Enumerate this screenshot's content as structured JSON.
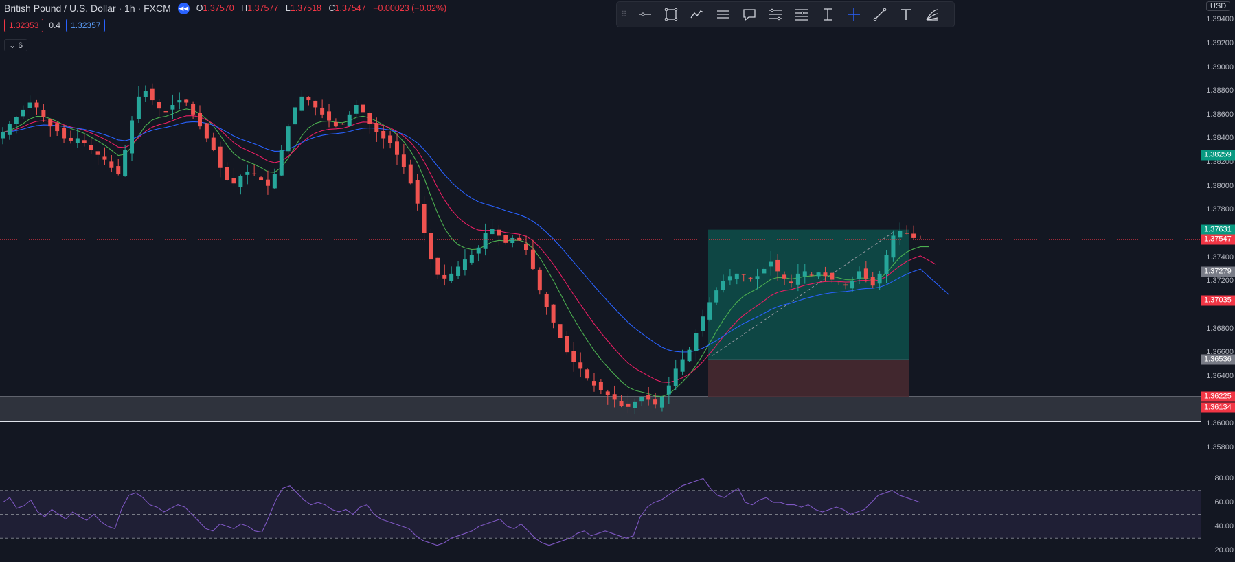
{
  "header": {
    "symbol_title": "British Pound / U.S. Dollar · 1h · FXCM",
    "replay_icon": "replay-icon",
    "ohlc": [
      {
        "label": "O",
        "value": "1.37570"
      },
      {
        "label": "H",
        "value": "1.37577"
      },
      {
        "label": "L",
        "value": "1.37518"
      },
      {
        "label": "C",
        "value": "1.37547"
      },
      {
        "label": "",
        "value": "−0.00023 (−0.02%)"
      }
    ]
  },
  "indicator": {
    "value_left": "1.32353",
    "param": "0.4",
    "value_right": "1.32357"
  },
  "collapse_label": "6",
  "currency_button": "USD",
  "toolbar": {
    "tools": [
      "horizontal-ray-icon",
      "rectangle-icon",
      "path-icon",
      "parallel-lines-icon",
      "callout-icon",
      "position-icon",
      "fib-icon",
      "price-range-icon",
      "crosshair-icon",
      "trend-line-icon",
      "text-icon",
      "fib-fan-icon"
    ]
  },
  "colors": {
    "background": "#131722",
    "bull": "#26a69a",
    "bear": "#ef5350",
    "ma_fast": "#4caf50",
    "ma_mid": "#e91e63",
    "ma_slow": "#2962ff",
    "rsi": "#7e57c2",
    "target_zone": "#0e4f4a",
    "stop_zone": "#4a2a30"
  },
  "chart_data": {
    "type": "candlestick",
    "timeframe": "1h",
    "ylim": [
      1.357,
      1.395
    ],
    "y_ticks": [
      "1.39400",
      "1.39200",
      "1.39000",
      "1.38800",
      "1.38600",
      "1.38400",
      "1.38200",
      "1.38000",
      "1.37800",
      "1.37400",
      "1.37200",
      "1.36800",
      "1.36600",
      "1.36400",
      "1.36000",
      "1.35800"
    ],
    "price_labels": [
      {
        "value": "1.38259",
        "price": 1.38259,
        "color": "#089981"
      },
      {
        "value": "1.37631",
        "price": 1.37631,
        "color": "#089981"
      },
      {
        "value": "1.37547",
        "price": 1.37547,
        "color": "#f23645"
      },
      {
        "value": "1.37279",
        "price": 1.37279,
        "color": "#787b86"
      },
      {
        "value": "1.37035",
        "price": 1.37035,
        "color": "#f23645"
      },
      {
        "value": "1.36536",
        "price": 1.36536,
        "color": "#787b86"
      },
      {
        "value": "1.36225",
        "price": 1.36225,
        "color": "#f23645"
      },
      {
        "value": "1.36134",
        "price": 1.36134,
        "color": "#f23645"
      }
    ],
    "close_series": [
      1.3845,
      1.3852,
      1.3858,
      1.3864,
      1.387,
      1.3866,
      1.3858,
      1.385,
      1.3846,
      1.384,
      1.3838,
      1.384,
      1.3836,
      1.383,
      1.3826,
      1.3822,
      1.3815,
      1.381,
      1.383,
      1.3855,
      1.3875,
      1.388,
      1.3872,
      1.3865,
      1.3862,
      1.3868,
      1.3872,
      1.387,
      1.386,
      1.385,
      1.384,
      1.383,
      1.3815,
      1.3805,
      1.3802,
      1.3808,
      1.3812,
      1.381,
      1.3805,
      1.38,
      1.381,
      1.383,
      1.385,
      1.3866,
      1.3875,
      1.3872,
      1.3866,
      1.386,
      1.3855,
      1.385,
      1.3852,
      1.386,
      1.3868,
      1.3862,
      1.3852,
      1.3845,
      1.384,
      1.3836,
      1.3826,
      1.3816,
      1.3802,
      1.3785,
      1.376,
      1.3738,
      1.3725,
      1.3722,
      1.3726,
      1.3732,
      1.3738,
      1.3742,
      1.3748,
      1.376,
      1.3764,
      1.3758,
      1.3752,
      1.3756,
      1.3754,
      1.3746,
      1.373,
      1.3712,
      1.3698,
      1.3685,
      1.3672,
      1.366,
      1.3652,
      1.3646,
      1.3638,
      1.3632,
      1.3628,
      1.3624,
      1.362,
      1.3615,
      1.3614,
      1.3618,
      1.3622,
      1.362,
      1.3616,
      1.3622,
      1.3632,
      1.3646,
      1.3654,
      1.3662,
      1.3676,
      1.369,
      1.3702,
      1.3712,
      1.372,
      1.3724,
      1.3726,
      1.3725,
      1.3722,
      1.3724,
      1.373,
      1.3736,
      1.3728,
      1.3722,
      1.3718,
      1.3726,
      1.3728,
      1.3725,
      1.3727,
      1.3724,
      1.3721,
      1.3718,
      1.3716,
      1.372,
      1.3728,
      1.3722,
      1.3716,
      1.3726,
      1.3742,
      1.3758,
      1.3762,
      1.376,
      1.3756,
      1.3755
    ],
    "series": [
      {
        "indicator": "ma_fast",
        "period": 8
      },
      {
        "indicator": "ma_mid",
        "period": 14
      },
      {
        "indicator": "ma_slow",
        "period": 26
      }
    ],
    "zones": {
      "support_zone": {
        "top": 1.36225,
        "bottom": 1.36015
      },
      "long_position": {
        "entry": 1.36536,
        "target": 1.37631,
        "stop": 1.36225
      }
    },
    "rsi": {
      "ticks": [
        "80.00",
        "60.00",
        "40.00",
        "20.00"
      ],
      "ylim": [
        10,
        90
      ],
      "band": [
        30,
        70
      ],
      "values": [
        60,
        64,
        55,
        57,
        62,
        52,
        48,
        54,
        50,
        46,
        52,
        48,
        45,
        50,
        44,
        40,
        38,
        55,
        66,
        68,
        64,
        58,
        56,
        52,
        55,
        58,
        56,
        50,
        44,
        38,
        36,
        42,
        40,
        38,
        42,
        40,
        36,
        35,
        48,
        62,
        72,
        74,
        68,
        62,
        58,
        60,
        58,
        54,
        52,
        54,
        50,
        56,
        58,
        50,
        46,
        44,
        42,
        40,
        38,
        32,
        28,
        26,
        24,
        26,
        30,
        32,
        34,
        36,
        40,
        42,
        44,
        46,
        40,
        38,
        42,
        36,
        30,
        26,
        24,
        26,
        28,
        30,
        34,
        36,
        32,
        34,
        36,
        34,
        32,
        30,
        32,
        48,
        56,
        60,
        62,
        66,
        70,
        74,
        76,
        78,
        80,
        72,
        66,
        64,
        68,
        72,
        60,
        58,
        62,
        64,
        60,
        60,
        58,
        58,
        56,
        58,
        54,
        52,
        54,
        56,
        54,
        50,
        52,
        54,
        60,
        66,
        68,
        70,
        66,
        64,
        62,
        60
      ]
    }
  }
}
